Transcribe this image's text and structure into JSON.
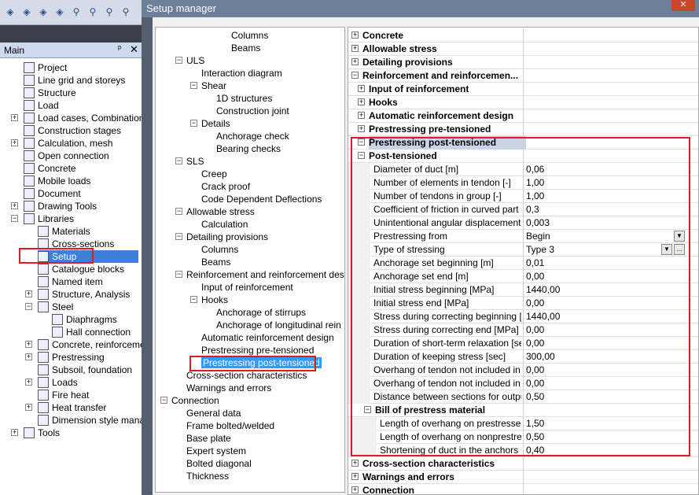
{
  "toolbar_icons": [
    "x",
    "y",
    "z",
    "3d",
    "zoom",
    "zoom",
    "zoom",
    "zoom"
  ],
  "main_panel": {
    "title": "Main",
    "pin": "ᵖ",
    "close": "✕"
  },
  "left_tree": [
    {
      "label": "Project",
      "indent": 0,
      "pm": ""
    },
    {
      "label": "Line grid and storeys",
      "indent": 0,
      "pm": ""
    },
    {
      "label": "Structure",
      "indent": 0,
      "pm": ""
    },
    {
      "label": "Load",
      "indent": 0,
      "pm": ""
    },
    {
      "label": "Load cases, Combinations",
      "indent": 0,
      "pm": "+"
    },
    {
      "label": "Construction stages",
      "indent": 0,
      "pm": ""
    },
    {
      "label": "Calculation, mesh",
      "indent": 0,
      "pm": "+"
    },
    {
      "label": "Open connection",
      "indent": 0,
      "pm": ""
    },
    {
      "label": "Concrete",
      "indent": 0,
      "pm": ""
    },
    {
      "label": "Mobile loads",
      "indent": 0,
      "pm": ""
    },
    {
      "label": "Document",
      "indent": 0,
      "pm": ""
    },
    {
      "label": "Drawing Tools",
      "indent": 0,
      "pm": "+"
    },
    {
      "label": "Libraries",
      "indent": 0,
      "pm": "−"
    },
    {
      "label": "Materials",
      "indent": 1,
      "pm": ""
    },
    {
      "label": "Cross-sections",
      "indent": 1,
      "pm": ""
    },
    {
      "label": "Setup",
      "indent": 1,
      "pm": "",
      "selected": true
    },
    {
      "label": "Catalogue blocks",
      "indent": 1,
      "pm": ""
    },
    {
      "label": "Named item",
      "indent": 1,
      "pm": ""
    },
    {
      "label": "Structure, Analysis",
      "indent": 1,
      "pm": "+"
    },
    {
      "label": "Steel",
      "indent": 1,
      "pm": "−"
    },
    {
      "label": "Diaphragms",
      "indent": 2,
      "pm": ""
    },
    {
      "label": "Hall connection",
      "indent": 2,
      "pm": ""
    },
    {
      "label": "Concrete, reinforcemer",
      "indent": 1,
      "pm": "+"
    },
    {
      "label": "Prestressing",
      "indent": 1,
      "pm": "+"
    },
    {
      "label": "Subsoil, foundation",
      "indent": 1,
      "pm": ""
    },
    {
      "label": "Loads",
      "indent": 1,
      "pm": "+"
    },
    {
      "label": "Fire heat",
      "indent": 1,
      "pm": ""
    },
    {
      "label": "Heat transfer",
      "indent": 1,
      "pm": "+"
    },
    {
      "label": "Dimension style manag",
      "indent": 1,
      "pm": ""
    },
    {
      "label": "Tools",
      "indent": 0,
      "pm": "+"
    }
  ],
  "dialog": {
    "title": "Setup manager",
    "close": "✕"
  },
  "mid_tree": [
    {
      "label": "Columns",
      "indent": 4,
      "pm": ""
    },
    {
      "label": "Beams",
      "indent": 4,
      "pm": ""
    },
    {
      "label": "ULS",
      "indent": 1,
      "pm": "−"
    },
    {
      "label": "Interaction diagram",
      "indent": 2,
      "pm": ""
    },
    {
      "label": "Shear",
      "indent": 2,
      "pm": "−"
    },
    {
      "label": "1D structures",
      "indent": 3,
      "pm": ""
    },
    {
      "label": "Construction joint",
      "indent": 3,
      "pm": ""
    },
    {
      "label": "Details",
      "indent": 2,
      "pm": "−"
    },
    {
      "label": "Anchorage check",
      "indent": 3,
      "pm": ""
    },
    {
      "label": "Bearing checks",
      "indent": 3,
      "pm": ""
    },
    {
      "label": "SLS",
      "indent": 1,
      "pm": "−"
    },
    {
      "label": "Creep",
      "indent": 2,
      "pm": ""
    },
    {
      "label": "Crack proof",
      "indent": 2,
      "pm": ""
    },
    {
      "label": "Code Dependent Deflections",
      "indent": 2,
      "pm": ""
    },
    {
      "label": "Allowable stress",
      "indent": 1,
      "pm": "−"
    },
    {
      "label": "Calculation",
      "indent": 2,
      "pm": ""
    },
    {
      "label": "Detailing provisions",
      "indent": 1,
      "pm": "−"
    },
    {
      "label": "Columns",
      "indent": 2,
      "pm": ""
    },
    {
      "label": "Beams",
      "indent": 2,
      "pm": ""
    },
    {
      "label": "Reinforcement and reinforcement des",
      "indent": 1,
      "pm": "−"
    },
    {
      "label": "Input of reinforcement",
      "indent": 2,
      "pm": ""
    },
    {
      "label": "Hooks",
      "indent": 2,
      "pm": "−"
    },
    {
      "label": "Anchorage of stirrups",
      "indent": 3,
      "pm": ""
    },
    {
      "label": "Anchorage of longitudinal rein",
      "indent": 3,
      "pm": ""
    },
    {
      "label": "Automatic reinforcement design",
      "indent": 2,
      "pm": ""
    },
    {
      "label": "Prestressing pre-tensioned",
      "indent": 2,
      "pm": ""
    },
    {
      "label": "Prestressing post-tensioned",
      "indent": 2,
      "pm": "",
      "selected": true
    },
    {
      "label": "Cross-section characteristics",
      "indent": 1,
      "pm": ""
    },
    {
      "label": "Warnings and errors",
      "indent": 1,
      "pm": ""
    },
    {
      "label": "Connection",
      "indent": 0,
      "pm": "−"
    },
    {
      "label": "General data",
      "indent": 1,
      "pm": ""
    },
    {
      "label": "Frame bolted/welded",
      "indent": 1,
      "pm": ""
    },
    {
      "label": "Base plate",
      "indent": 1,
      "pm": ""
    },
    {
      "label": "Expert system",
      "indent": 1,
      "pm": ""
    },
    {
      "label": "Bolted diagonal",
      "indent": 1,
      "pm": ""
    },
    {
      "label": "Thickness",
      "indent": 1,
      "pm": ""
    }
  ],
  "prop_grid": [
    {
      "name": "Concrete",
      "value": "",
      "level": 0,
      "pm": "+",
      "cat": true
    },
    {
      "name": "Allowable stress",
      "value": "",
      "level": 0,
      "pm": "+",
      "cat": true
    },
    {
      "name": "Detailing provisions",
      "value": "",
      "level": 0,
      "pm": "+",
      "cat": true
    },
    {
      "name": "Reinforcement and reinforcemen...",
      "value": "",
      "level": 0,
      "pm": "−",
      "cat": true
    },
    {
      "name": "Input of reinforcement",
      "value": "",
      "level": 1,
      "pm": "+",
      "cat": true
    },
    {
      "name": "Hooks",
      "value": "",
      "level": 1,
      "pm": "+",
      "cat": true
    },
    {
      "name": "Automatic reinforcement design",
      "value": "",
      "level": 1,
      "pm": "+",
      "cat": true
    },
    {
      "name": "Prestressing pre-tensioned",
      "value": "",
      "level": 1,
      "pm": "+",
      "cat": true
    },
    {
      "name": "Prestressing post-tensioned",
      "value": "",
      "level": 1,
      "pm": "−",
      "cat": true,
      "highlight": true
    },
    {
      "name": "Post-tensioned",
      "value": "",
      "level": 1,
      "pm": "−",
      "cat": true
    },
    {
      "name": "Diameter of duct [m]",
      "value": "0,06",
      "level": 2
    },
    {
      "name": "Number of elements in tendon [-]",
      "value": "1,00",
      "level": 2
    },
    {
      "name": "Number of tendons in group [-]",
      "value": "1,00",
      "level": 2
    },
    {
      "name": "Coefficient of friction in curved part of...",
      "value": "0,3",
      "level": 2
    },
    {
      "name": "Unintentional angular displacement (...",
      "value": "0,003",
      "level": 2
    },
    {
      "name": "Prestressing from",
      "value": "Begin",
      "level": 2,
      "dropdown": true
    },
    {
      "name": "Type of stressing",
      "value": "Type 3",
      "level": 2,
      "dropdown": true,
      "ellipsis": true
    },
    {
      "name": "Anchorage set  beginning [m]",
      "value": "0,01",
      "level": 2
    },
    {
      "name": "Anchorage set  end [m]",
      "value": "0,00",
      "level": 2
    },
    {
      "name": "Initial stress  beginning [MPa]",
      "value": "1440,00",
      "level": 2
    },
    {
      "name": "Initial stress  end [MPa]",
      "value": "0,00",
      "level": 2
    },
    {
      "name": "Stress during correcting  beginning [...",
      "value": "1440,00",
      "level": 2
    },
    {
      "name": "Stress during correcting  end [MPa]",
      "value": "0,00",
      "level": 2
    },
    {
      "name": "Duration of short-term relaxation [sec]",
      "value": "0,00",
      "level": 2
    },
    {
      "name": "Duration of keeping stress [sec]",
      "value": "300,00",
      "level": 2
    },
    {
      "name": "Overhang of tendon not included in s...",
      "value": "0,00",
      "level": 2
    },
    {
      "name": "Overhang of tendon not included in s...",
      "value": "0,00",
      "level": 2
    },
    {
      "name": "Distance between sections for output...",
      "value": "0,50",
      "level": 2
    },
    {
      "name": "Bill of prestress material",
      "value": "",
      "level": 2,
      "pm": "−",
      "cat": true
    },
    {
      "name": "Length of overhang on prestressed ...",
      "value": "1,50",
      "level": 3
    },
    {
      "name": "Length of overhang on nonprestres...",
      "value": "0,50",
      "level": 3
    },
    {
      "name": "Shortening of duct in the anchors  [m]",
      "value": "0,40",
      "level": 3
    },
    {
      "name": "Cross-section characteristics",
      "value": "",
      "level": 0,
      "pm": "+",
      "cat": true
    },
    {
      "name": "Warnings and errors",
      "value": "",
      "level": 0,
      "pm": "+",
      "cat": true
    },
    {
      "name": "Connection",
      "value": "",
      "level": 0,
      "pm": "+",
      "cat": true
    }
  ],
  "dd_arrow": "▼",
  "ellipsis_btn": "...",
  "scroll_up": "▲",
  "scroll_down": "▼",
  "scroll_grip": "≡"
}
